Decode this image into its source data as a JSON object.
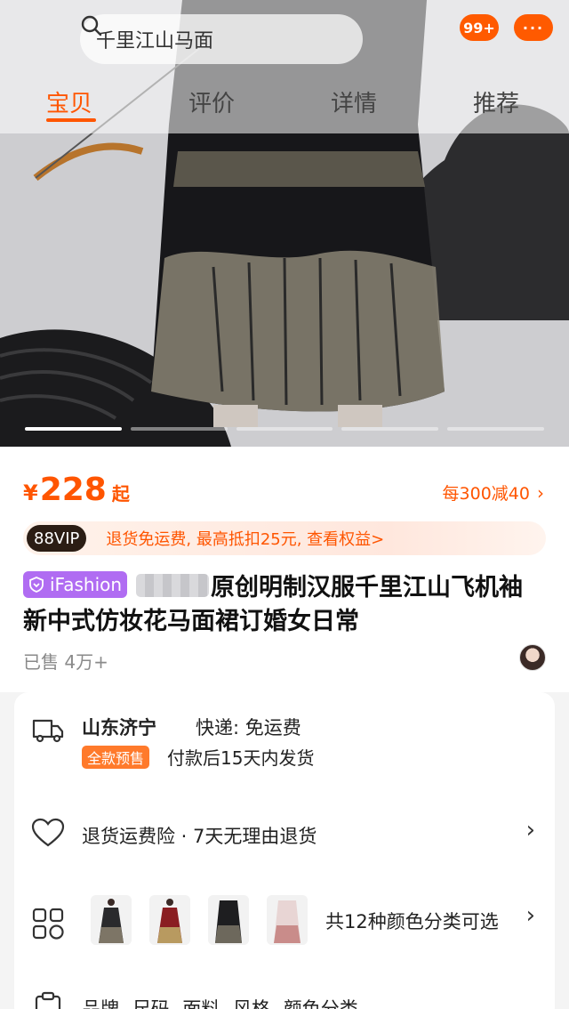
{
  "search": {
    "query": "千里江山马面"
  },
  "header": {
    "cart_badge": "99+",
    "more_badge": "···"
  },
  "tabs": [
    {
      "label": "宝贝",
      "active": true
    },
    {
      "label": "评价",
      "active": false
    },
    {
      "label": "详情",
      "active": false
    },
    {
      "label": "推荐",
      "active": false
    }
  ],
  "carousel": {
    "count": 5,
    "active_index": 0
  },
  "product": {
    "price_currency": "¥",
    "price": "228",
    "price_suffix": "起",
    "promo": "每300减40",
    "vip_badge": "88VIP",
    "vip_benefit": "退货免运费, 最高抵扣25元, 查看权益>",
    "brand_badge": "iFashion",
    "title": "原创明制汉服千里江山飞机袖新中式仿妆花马面裙订婚女日常",
    "sold": "已售 4万+"
  },
  "service": {
    "ship_from": "山东济宁",
    "express": "快递: 免运费",
    "presale_tag": "全款预售",
    "ship_time": "付款后15天内发货",
    "return_policy": "退货运费险 · 7天无理由退货",
    "variants_text": "共12种颜色分类可选",
    "params": "品牌  尺码  面料  风格  颜色分类"
  },
  "colors": {
    "accent": "#ff5500",
    "badge": "#ff5a00",
    "ifashion": "#b06cf2",
    "vip_bg": "#2b1d14"
  }
}
